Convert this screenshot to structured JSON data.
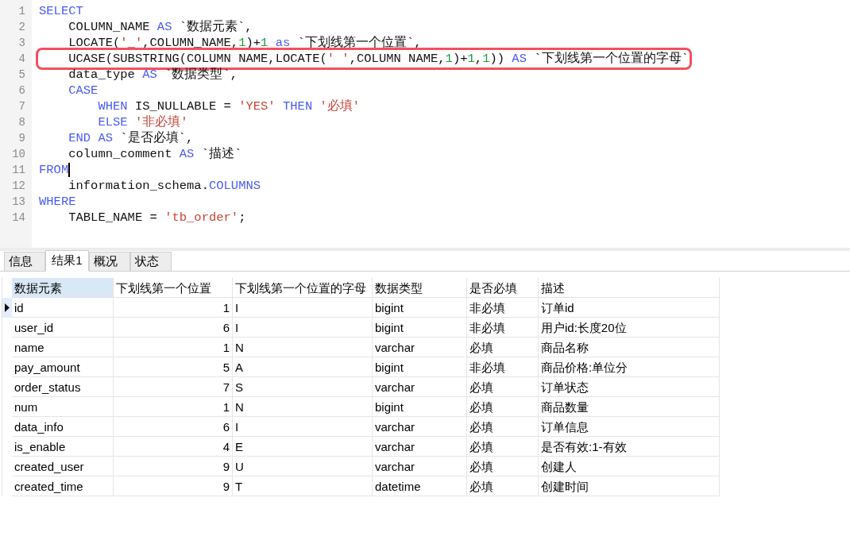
{
  "editor": {
    "lines": [
      {
        "number": "1",
        "tokens": [
          {
            "kind": "kw",
            "text": "SELECT"
          }
        ]
      },
      {
        "number": "2",
        "tokens": [
          {
            "kind": "plain",
            "text": "    COLUMN_NAME "
          },
          {
            "kind": "kw",
            "text": "AS"
          },
          {
            "kind": "plain",
            "text": " `数据元素`,"
          }
        ]
      },
      {
        "number": "3",
        "tokens": [
          {
            "kind": "plain",
            "text": "    LOCATE("
          },
          {
            "kind": "str",
            "text": "'_'"
          },
          {
            "kind": "plain",
            "text": ",COLUMN_NAME,"
          },
          {
            "kind": "num",
            "text": "1"
          },
          {
            "kind": "plain",
            "text": ")+"
          },
          {
            "kind": "num",
            "text": "1"
          },
          {
            "kind": "kw",
            "text": " as"
          },
          {
            "kind": "plain",
            "text": " `下划线第一个位置`,"
          }
        ]
      },
      {
        "number": "4",
        "highlighted": true,
        "tokens": [
          {
            "kind": "plain",
            "text": "    UCASE(SUBSTRING(COLUMN NAME,LOCATE("
          },
          {
            "kind": "str",
            "text": "' '"
          },
          {
            "kind": "plain",
            "text": ",COLUMN NAME,"
          },
          {
            "kind": "num",
            "text": "1"
          },
          {
            "kind": "plain",
            "text": ")+"
          },
          {
            "kind": "num",
            "text": "1"
          },
          {
            "kind": "plain",
            "text": ","
          },
          {
            "kind": "num",
            "text": "1"
          },
          {
            "kind": "plain",
            "text": ")) "
          },
          {
            "kind": "kw",
            "text": "AS"
          },
          {
            "kind": "plain",
            "text": " `下划线第一个位置的字母`"
          }
        ]
      },
      {
        "number": "5",
        "tokens": [
          {
            "kind": "plain",
            "text": "    data_type "
          },
          {
            "kind": "kw",
            "text": "AS"
          },
          {
            "kind": "plain",
            "text": " `数据类型`,"
          }
        ]
      },
      {
        "number": "6",
        "tokens": [
          {
            "kind": "kw",
            "text": "    CASE"
          }
        ]
      },
      {
        "number": "7",
        "tokens": [
          {
            "kind": "kw",
            "text": "        WHEN"
          },
          {
            "kind": "plain",
            "text": " IS_NULLABLE = "
          },
          {
            "kind": "str",
            "text": "'YES'"
          },
          {
            "kind": "kw",
            "text": " THEN "
          },
          {
            "kind": "str",
            "text": "'必填'"
          }
        ]
      },
      {
        "number": "8",
        "tokens": [
          {
            "kind": "kw",
            "text": "        ELSE "
          },
          {
            "kind": "str",
            "text": "'非必填'"
          }
        ]
      },
      {
        "number": "9",
        "tokens": [
          {
            "kind": "kw",
            "text": "    END AS"
          },
          {
            "kind": "plain",
            "text": " `是否必填`,"
          }
        ]
      },
      {
        "number": "10",
        "tokens": [
          {
            "kind": "plain",
            "text": "    column_comment "
          },
          {
            "kind": "kw",
            "text": "AS"
          },
          {
            "kind": "plain",
            "text": " `描述`"
          }
        ]
      },
      {
        "number": "11",
        "cursor": true,
        "tokens": [
          {
            "kind": "kw",
            "text": "FROM"
          }
        ]
      },
      {
        "number": "12",
        "tokens": [
          {
            "kind": "plain",
            "text": "    information_schema."
          },
          {
            "kind": "kw",
            "text": "COLUMNS"
          }
        ]
      },
      {
        "number": "13",
        "tokens": [
          {
            "kind": "kw",
            "text": "WHERE"
          }
        ]
      },
      {
        "number": "14",
        "tokens": [
          {
            "kind": "plain",
            "text": "    TABLE_NAME = "
          },
          {
            "kind": "str",
            "text": "'tb_order'"
          },
          {
            "kind": "plain",
            "text": ";"
          }
        ]
      }
    ]
  },
  "tabs": [
    {
      "label": "信息",
      "selected": false
    },
    {
      "label": "结果1",
      "selected": true
    },
    {
      "label": "概况",
      "selected": false
    },
    {
      "label": "状态",
      "selected": false
    }
  ],
  "table": {
    "columns": [
      {
        "label": "数据元素",
        "selected": true
      },
      {
        "label": "下划线第一个位置",
        "selected": false
      },
      {
        "label": "下划线第一个位置的字母",
        "selected": false
      },
      {
        "label": "数据类型",
        "selected": false
      },
      {
        "label": "是否必填",
        "selected": false
      },
      {
        "label": "描述",
        "selected": false
      }
    ],
    "rows": [
      {
        "selected": true,
        "cells": [
          "id",
          "1",
          "I",
          "bigint",
          "非必填",
          "订单id"
        ]
      },
      {
        "selected": false,
        "cells": [
          "user_id",
          "6",
          "I",
          "bigint",
          "非必填",
          "用户id:长度20位"
        ]
      },
      {
        "selected": false,
        "cells": [
          "name",
          "1",
          "N",
          "varchar",
          "必填",
          "商品名称"
        ]
      },
      {
        "selected": false,
        "cells": [
          "pay_amount",
          "5",
          "A",
          "bigint",
          "非必填",
          "商品价格:单位分"
        ]
      },
      {
        "selected": false,
        "cells": [
          "order_status",
          "7",
          "S",
          "varchar",
          "必填",
          "订单状态"
        ]
      },
      {
        "selected": false,
        "cells": [
          "num",
          "1",
          "N",
          "bigint",
          "必填",
          "商品数量"
        ]
      },
      {
        "selected": false,
        "cells": [
          "data_info",
          "6",
          "I",
          "varchar",
          "必填",
          "订单信息"
        ]
      },
      {
        "selected": false,
        "cells": [
          "is_enable",
          "4",
          "E",
          "varchar",
          "必填",
          "是否有效:1-有效"
        ]
      },
      {
        "selected": false,
        "cells": [
          "created_user",
          "9",
          "U",
          "varchar",
          "必填",
          "创建人"
        ]
      },
      {
        "selected": false,
        "cells": [
          "created_time",
          "9",
          "T",
          "datetime",
          "必填",
          "创建时间"
        ]
      }
    ]
  }
}
